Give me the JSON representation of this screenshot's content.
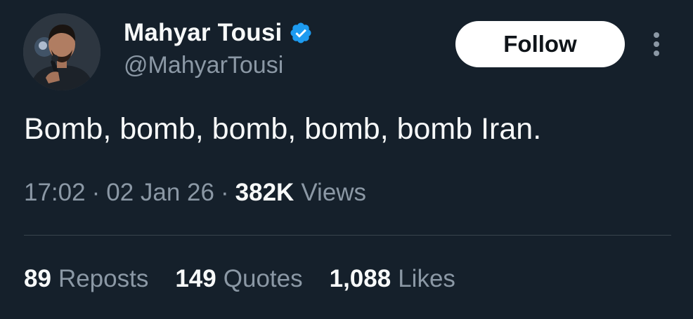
{
  "author": {
    "display_name": "Mahyar Tousi",
    "handle": "@MahyarTousi",
    "verified": true
  },
  "actions": {
    "follow_label": "Follow"
  },
  "tweet": {
    "text": "Bomb, bomb, bomb, bomb, bomb Iran.",
    "time": "17:02",
    "date": "02 Jan 26",
    "views_count": "382K",
    "views_label": "Views",
    "separator": "·"
  },
  "stats": {
    "reposts_count": "89",
    "reposts_label": "Reposts",
    "quotes_count": "149",
    "quotes_label": "Quotes",
    "likes_count": "1,088",
    "likes_label": "Likes"
  },
  "colors": {
    "background": "#15202b",
    "primary_text": "#f7f9f9",
    "secondary_text": "#8b98a5",
    "verified_badge": "#1d9bf0",
    "follow_button_bg": "#ffffff",
    "divider": "#38444d"
  },
  "icons": {
    "verified": "verified-badge-icon",
    "more": "more-vertical-icon"
  }
}
